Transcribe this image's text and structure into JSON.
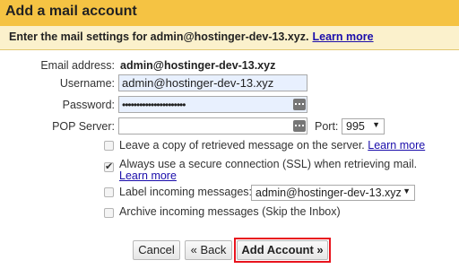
{
  "dialog": {
    "title": "Add a mail account",
    "instruction": "Enter the mail settings for admin@hostinger-dev-13.xyz.",
    "learn_more": "Learn more"
  },
  "form": {
    "email_label": "Email address:",
    "email_value": "admin@hostinger-dev-13.xyz",
    "username_label": "Username:",
    "username_value": "admin@hostinger-dev-13.xyz",
    "password_label": "Password:",
    "password_value": "••••••••••••••••••••••",
    "pop_server_label": "POP Server:",
    "pop_server_value": "",
    "port_label": "Port:",
    "port_value": "995"
  },
  "options": {
    "leave_copy": {
      "label": "Leave a copy of retrieved message on the server.",
      "link": "Learn more",
      "checked": false
    },
    "ssl": {
      "label": "Always use a secure connection (SSL) when retrieving mail.",
      "link": "Learn more",
      "checked": true
    },
    "label_incoming": {
      "label": "Label incoming messages:",
      "select_value": "admin@hostinger-dev-13.xyz",
      "checked": false
    },
    "archive": {
      "label": "Archive incoming messages (Skip the Inbox)",
      "checked": false
    }
  },
  "buttons": {
    "cancel": "Cancel",
    "back": "« Back",
    "add_account": "Add Account »"
  },
  "colors": {
    "title_bar": "#f5c343",
    "sub_bar": "#fbf1cc",
    "link": "#1a0dab",
    "highlight_box": "#e8141e"
  }
}
